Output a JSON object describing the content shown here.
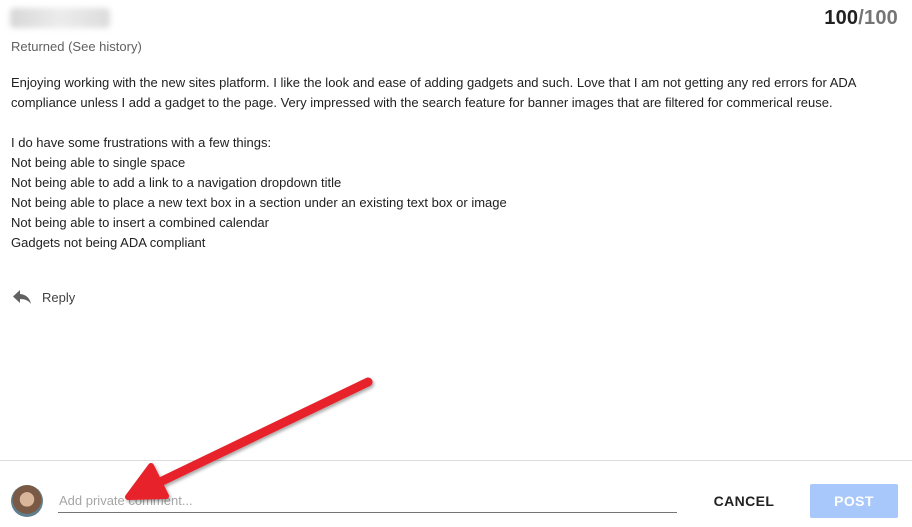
{
  "header": {
    "grade_score": "100",
    "grade_slash": "/",
    "grade_total": "100",
    "status": "Returned (See history)"
  },
  "submission": {
    "paragraphs": [
      "Enjoying working with the new sites platform. I like the look and ease of adding gadgets and such. Love that I am not getting any red errors for ADA compliance unless I add a gadget to the page. Very impressed with the search feature for banner images that are filtered for commerical reuse.",
      "I do have some frustrations with a few things:",
      "Not being able to single space",
      "Not being able to add a link to a navigation dropdown title",
      "Not being able to place a new text box in a section under an existing text box or image",
      "Not being able to insert a combined calendar",
      "Gadgets not being ADA compliant"
    ]
  },
  "reply": {
    "label": "Reply",
    "icon": "reply-icon"
  },
  "comment_bar": {
    "placeholder": "Add private comment...",
    "cancel_label": "CANCEL",
    "post_label": "POST"
  },
  "colors": {
    "post_disabled_bg": "#a8c7fa",
    "annotation_arrow": "#e8202a"
  }
}
